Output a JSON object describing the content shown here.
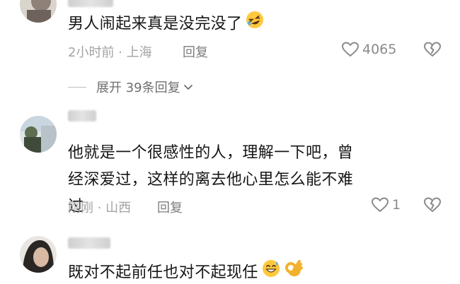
{
  "comments": [
    {
      "text": "男人闹起来真是没完没了",
      "emoji": "rolling-on-floor-laughing",
      "meta": "2小时前 · 上海",
      "reply_label": "回复",
      "like_count": "4065"
    },
    {
      "text": "他就是一个很感性的人，理解一下吧，曾经深爱过，这样的离去他心里怎么能不难过",
      "meta": "刚刚 · 山西",
      "reply_label": "回复",
      "like_count": "1"
    },
    {
      "text": "既对不起前任也对不起现任",
      "emojis": [
        "grinning-sweat",
        "ok-hand"
      ]
    }
  ],
  "expand_replies": {
    "label": "展开 39条回复"
  },
  "icons": {
    "like": "heart-outline-icon",
    "dislike": "broken-heart-icon",
    "expand": "chevron-down-icon"
  },
  "colors": {
    "text": "#161616",
    "meta": "#a3a3a3",
    "icon": "#8a8a8a"
  }
}
